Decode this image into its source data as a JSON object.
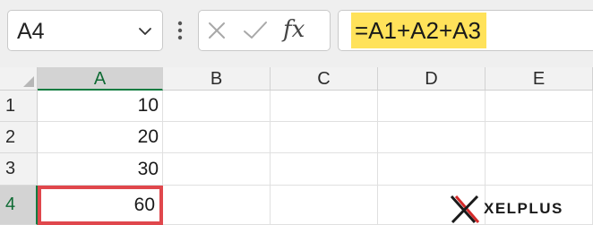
{
  "name_box": {
    "value": "A4",
    "caret_icon": "chevron-down-icon"
  },
  "toolbar": {
    "more_icon": "vertical-ellipsis-icon",
    "cancel_icon": "close-icon",
    "enter_icon": "checkmark-icon",
    "function_label": "fx"
  },
  "formula_bar": {
    "value": "=A1+A2+A3",
    "highlight_color": "#ffe25a"
  },
  "columns": [
    {
      "label": "A",
      "selected": true
    },
    {
      "label": "B",
      "selected": false
    },
    {
      "label": "C",
      "selected": false
    },
    {
      "label": "D",
      "selected": false
    },
    {
      "label": "E",
      "selected": false
    }
  ],
  "rows": [
    {
      "label": "1",
      "a": "10",
      "selected": false
    },
    {
      "label": "2",
      "a": "20",
      "selected": false
    },
    {
      "label": "3",
      "a": "30",
      "selected": false
    },
    {
      "label": "4",
      "a": "60",
      "selected": true
    }
  ],
  "active_cell": "A4",
  "colors": {
    "accent_green": "#107c41",
    "active_outline": "#e0474c",
    "logo_red": "#d42a2a"
  },
  "logo": {
    "text": "XELPLUS",
    "mark_icon": "x-logo-icon"
  }
}
